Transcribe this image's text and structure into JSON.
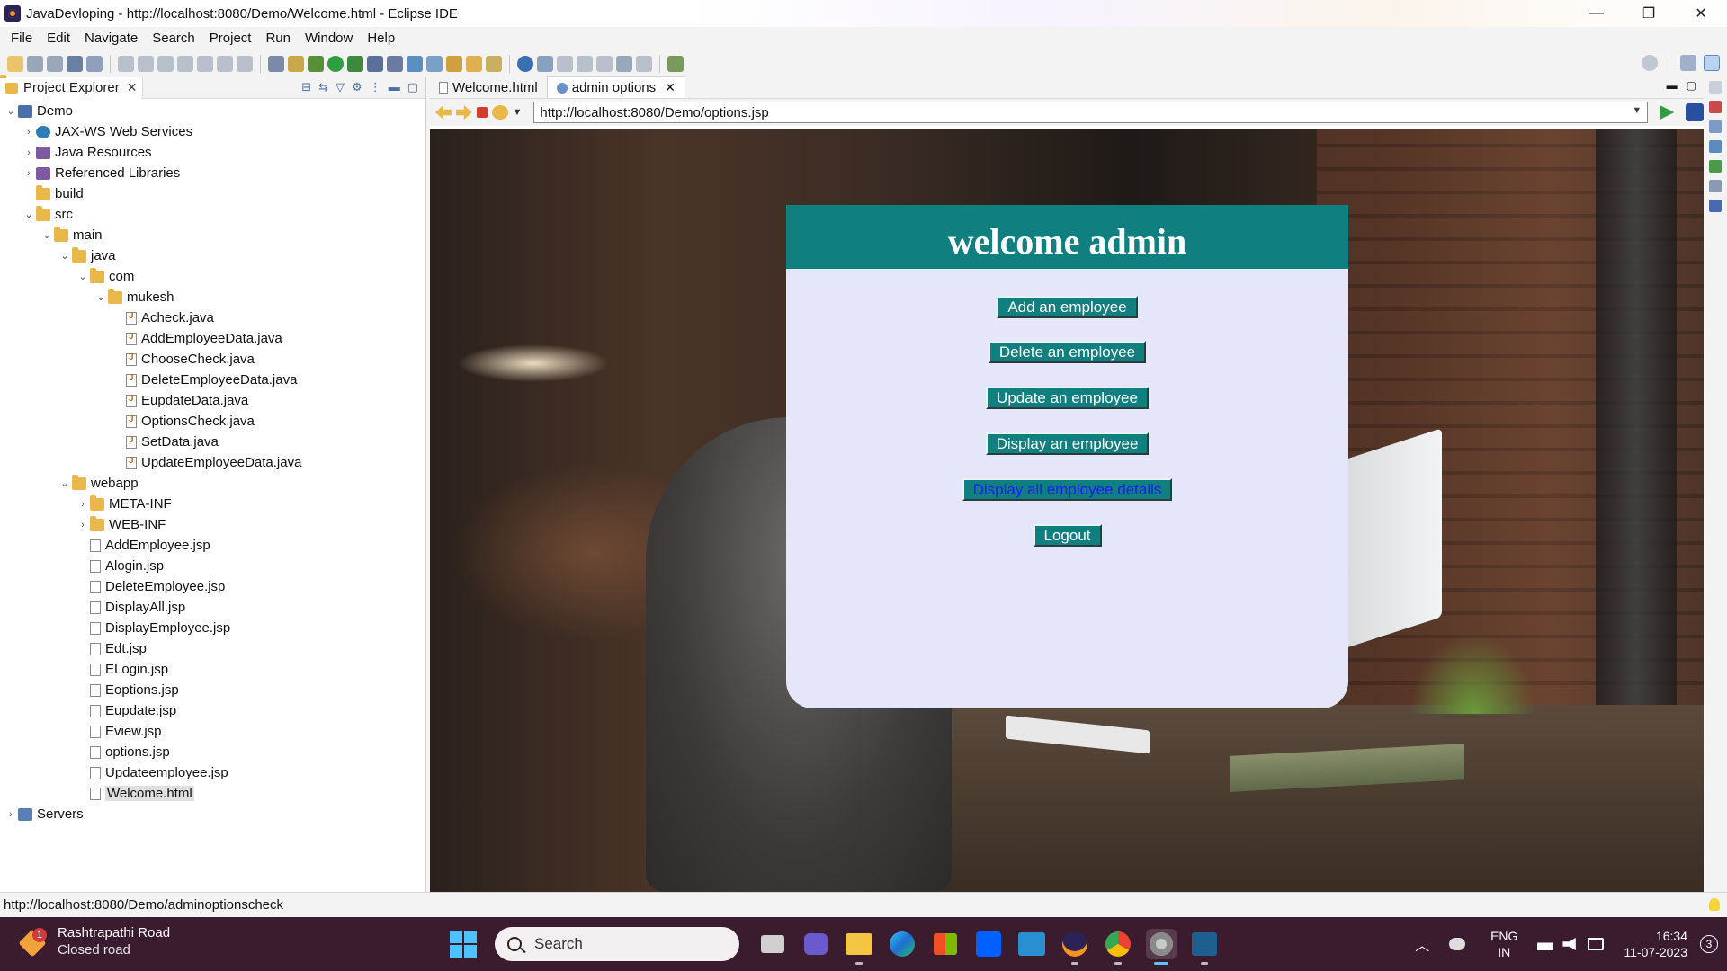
{
  "window": {
    "title": "JavaDevloping - http://localhost:8080/Demo/Welcome.html - Eclipse IDE",
    "controls": {
      "minimize": "—",
      "restore": "❐",
      "close": "✕"
    }
  },
  "menu": [
    "File",
    "Edit",
    "Navigate",
    "Search",
    "Project",
    "Run",
    "Window",
    "Help"
  ],
  "explorer": {
    "tab_label": "Project Explorer",
    "tree": [
      {
        "label": "Demo",
        "icon": "project-icon",
        "chevron": "v",
        "depth": 0
      },
      {
        "label": "JAX-WS Web Services",
        "icon": "web-services-icon",
        "chevron": ">",
        "depth": 1
      },
      {
        "label": "Java Resources",
        "icon": "java-resources-icon",
        "chevron": ">",
        "depth": 1
      },
      {
        "label": "Referenced Libraries",
        "icon": "library-icon",
        "chevron": ">",
        "depth": 1
      },
      {
        "label": "build",
        "icon": "folder-icon",
        "chevron": "",
        "depth": 1
      },
      {
        "label": "src",
        "icon": "folder-icon",
        "chevron": "v",
        "depth": 1
      },
      {
        "label": "main",
        "icon": "folder-icon",
        "chevron": "v",
        "depth": 2
      },
      {
        "label": "java",
        "icon": "folder-icon",
        "chevron": "v",
        "depth": 3
      },
      {
        "label": "com",
        "icon": "folder-icon",
        "chevron": "v",
        "depth": 4
      },
      {
        "label": "mukesh",
        "icon": "folder-icon",
        "chevron": "v",
        "depth": 5
      },
      {
        "label": "Acheck.java",
        "icon": "java-file-icon",
        "chevron": "",
        "depth": 6
      },
      {
        "label": "AddEmployeeData.java",
        "icon": "java-file-icon",
        "chevron": "",
        "depth": 6
      },
      {
        "label": "ChooseCheck.java",
        "icon": "java-file-icon",
        "chevron": "",
        "depth": 6
      },
      {
        "label": "DeleteEmployeeData.java",
        "icon": "java-file-icon",
        "chevron": "",
        "depth": 6
      },
      {
        "label": "EupdateData.java",
        "icon": "java-file-icon",
        "chevron": "",
        "depth": 6
      },
      {
        "label": "OptionsCheck.java",
        "icon": "java-file-icon",
        "chevron": "",
        "depth": 6
      },
      {
        "label": "SetData.java",
        "icon": "java-file-icon",
        "chevron": "",
        "depth": 6
      },
      {
        "label": "UpdateEmployeeData.java",
        "icon": "java-file-icon",
        "chevron": "",
        "depth": 6
      },
      {
        "label": "webapp",
        "icon": "folder-icon",
        "chevron": "v",
        "depth": 3
      },
      {
        "label": "META-INF",
        "icon": "folder-icon",
        "chevron": ">",
        "depth": 4
      },
      {
        "label": "WEB-INF",
        "icon": "folder-icon",
        "chevron": ">",
        "depth": 4
      },
      {
        "label": "AddEmployee.jsp",
        "icon": "jsp-file-icon",
        "chevron": "",
        "depth": 4
      },
      {
        "label": "Alogin.jsp",
        "icon": "jsp-file-icon",
        "chevron": "",
        "depth": 4
      },
      {
        "label": "DeleteEmployee.jsp",
        "icon": "jsp-file-icon",
        "chevron": "",
        "depth": 4
      },
      {
        "label": "DisplayAll.jsp",
        "icon": "jsp-file-icon",
        "chevron": "",
        "depth": 4
      },
      {
        "label": "DisplayEmployee.jsp",
        "icon": "jsp-file-icon",
        "chevron": "",
        "depth": 4
      },
      {
        "label": "Edt.jsp",
        "icon": "jsp-file-icon",
        "chevron": "",
        "depth": 4
      },
      {
        "label": "ELogin.jsp",
        "icon": "jsp-file-icon",
        "chevron": "",
        "depth": 4
      },
      {
        "label": "Eoptions.jsp",
        "icon": "jsp-file-icon",
        "chevron": "",
        "depth": 4
      },
      {
        "label": "Eupdate.jsp",
        "icon": "jsp-file-icon",
        "chevron": "",
        "depth": 4
      },
      {
        "label": "Eview.jsp",
        "icon": "jsp-file-icon",
        "chevron": "",
        "depth": 4
      },
      {
        "label": "options.jsp",
        "icon": "jsp-file-icon",
        "chevron": "",
        "depth": 4
      },
      {
        "label": "Updateemployee.jsp",
        "icon": "jsp-file-icon",
        "chevron": "",
        "depth": 4
      },
      {
        "label": "Welcome.html",
        "icon": "html-file-icon",
        "chevron": "",
        "depth": 4,
        "selected": true
      },
      {
        "label": "Servers",
        "icon": "server-icon",
        "chevron": ">",
        "depth": 0
      }
    ]
  },
  "editor": {
    "tabs": [
      {
        "label": "Welcome.html",
        "active": false
      },
      {
        "label": "admin options",
        "active": true
      }
    ],
    "url": "http://localhost:8080/Demo/options.jsp"
  },
  "admin_page": {
    "heading": "welcome admin",
    "buttons": [
      {
        "label": "Add an employee",
        "blue": false
      },
      {
        "label": "Delete an employee",
        "blue": false
      },
      {
        "label": "Update an employee",
        "blue": false
      },
      {
        "label": "Display an employee",
        "blue": false
      },
      {
        "label": "Display all employee details",
        "blue": true
      },
      {
        "label": "Logout",
        "blue": false
      }
    ]
  },
  "status": {
    "text": "http://localhost:8080/Demo/adminoptionscheck"
  },
  "taskbar": {
    "weather": {
      "location": "Rashtrapathi Road",
      "condition": "Closed road",
      "badge": "1"
    },
    "search_placeholder": "Search",
    "language_top": "ENG",
    "language_bottom": "IN",
    "time": "16:34",
    "date": "11-07-2023",
    "notifications": "3"
  },
  "colors": {
    "teal": "#0f7f7f",
    "lavender": "#e6e6fa",
    "taskbar": "#3b1b2e"
  }
}
